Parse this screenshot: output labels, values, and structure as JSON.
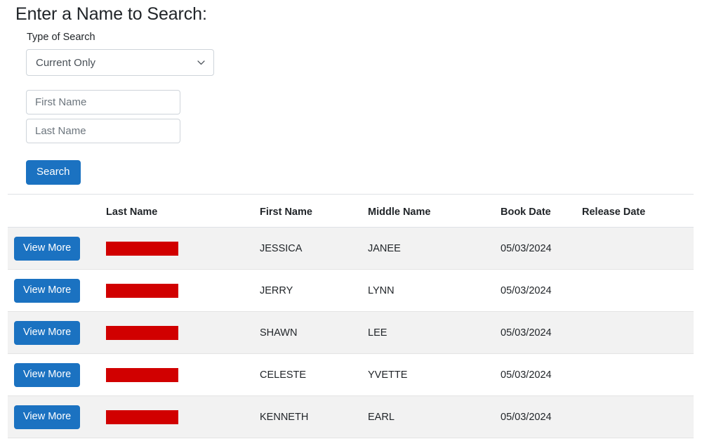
{
  "form": {
    "heading": "Enter a Name to Search:",
    "type_label": "Type of Search",
    "type_selected": "Current Only",
    "type_options": [
      "Current Only"
    ],
    "first_name_placeholder": "First Name",
    "first_name_value": "",
    "last_name_placeholder": "Last Name",
    "last_name_value": "",
    "search_button": "Search"
  },
  "table": {
    "columns": [
      {
        "key": "action",
        "label": ""
      },
      {
        "key": "last_name",
        "label": "Last Name"
      },
      {
        "key": "first_name",
        "label": "First Name"
      },
      {
        "key": "middle_name",
        "label": "Middle Name"
      },
      {
        "key": "book_date",
        "label": "Book Date"
      },
      {
        "key": "release_date",
        "label": "Release Date"
      }
    ],
    "action_label": "View More",
    "rows": [
      {
        "action": "View More",
        "last_name": "",
        "last_name_redacted": true,
        "first_name": "JESSICA",
        "middle_name": "JANEE",
        "book_date": "05/03/2024",
        "release_date": ""
      },
      {
        "action": "View More",
        "last_name": "",
        "last_name_redacted": true,
        "first_name": "JERRY",
        "middle_name": "LYNN",
        "book_date": "05/03/2024",
        "release_date": ""
      },
      {
        "action": "View More",
        "last_name": "",
        "last_name_redacted": true,
        "first_name": "SHAWN",
        "middle_name": "LEE",
        "book_date": "05/03/2024",
        "release_date": ""
      },
      {
        "action": "View More",
        "last_name": "",
        "last_name_redacted": true,
        "first_name": "CELESTE",
        "middle_name": "YVETTE",
        "book_date": "05/03/2024",
        "release_date": ""
      },
      {
        "action": "View More",
        "last_name": "",
        "last_name_redacted": true,
        "first_name": "KENNETH",
        "middle_name": "EARL",
        "book_date": "05/03/2024",
        "release_date": ""
      }
    ]
  },
  "colors": {
    "primary_blue": "#1b72c1",
    "redaction_red": "#d10000",
    "row_stripe": "#f2f2f2",
    "border": "#dee2e6",
    "text": "#212529",
    "placeholder": "#6c757d"
  },
  "icons": {
    "chevron_down": "chevron-down-icon"
  }
}
